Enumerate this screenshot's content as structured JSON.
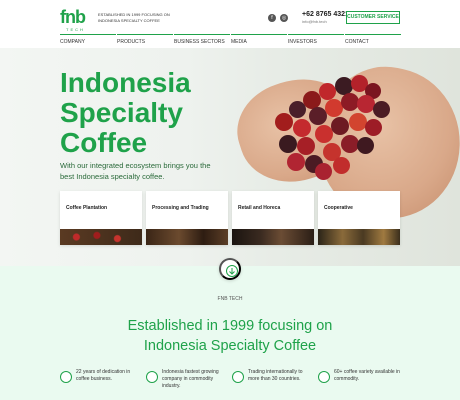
{
  "header": {
    "logo_text": "fnb",
    "logo_sub": "TECH",
    "tagline": "ESTABLISHED IN 1999 FOCUSING ON INDONESIA SPECIALTY COFFEE",
    "social_icons": [
      "facebook-icon",
      "instagram-icon"
    ],
    "phone": "+62 8765 4321",
    "email": "info@fnb.tech",
    "cta_label": "CUSTOMER SERVICE",
    "accent_color": "#1fa24a"
  },
  "nav": {
    "items": [
      {
        "label": "COMPANY"
      },
      {
        "label": "PRODUCTS"
      },
      {
        "label": "BUSINESS SECTORS"
      },
      {
        "label": "MEDIA"
      },
      {
        "label": "INVESTORS"
      },
      {
        "label": "CONTACT"
      }
    ]
  },
  "hero": {
    "title": "Indonesia Specialty Coffee",
    "subtitle": "With our integrated ecosystem brings you the best Indonesia specialty coffee.",
    "cards": [
      {
        "label": "Coffee Plantation"
      },
      {
        "label": "Processing and Trading"
      },
      {
        "label": "Retail and Horeca"
      },
      {
        "label": "Cooperative"
      }
    ]
  },
  "about": {
    "eyebrow": "FNB TECH",
    "title": "Established in 1999 focusing on Indonesia Specialty Coffee",
    "features": [
      {
        "text": "22 years of dedication in coffee business."
      },
      {
        "text": "Indonesia fastest growing company in commodity industry."
      },
      {
        "text": "Trading internationally to more than 30 countries."
      },
      {
        "text": "60+ coffee variety available in commodity."
      }
    ]
  }
}
